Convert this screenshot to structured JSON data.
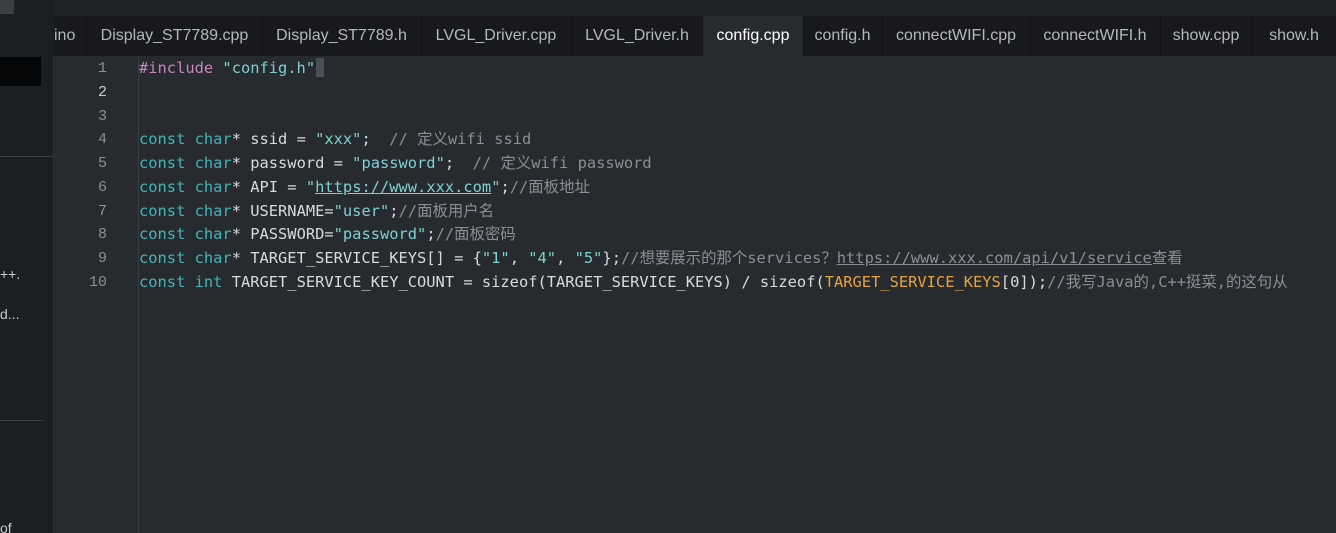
{
  "sidebar": {
    "fragments": [
      "++.",
      "d...",
      "of"
    ]
  },
  "tabs": [
    {
      "label": "ino",
      "active": false
    },
    {
      "label": "Display_ST7789.cpp",
      "active": false
    },
    {
      "label": "Display_ST7789.h",
      "active": false
    },
    {
      "label": "LVGL_Driver.cpp",
      "active": false
    },
    {
      "label": "LVGL_Driver.h",
      "active": false
    },
    {
      "label": "config.cpp",
      "active": true
    },
    {
      "label": "config.h",
      "active": false
    },
    {
      "label": "connectWIFI.cpp",
      "active": false
    },
    {
      "label": "connectWIFI.h",
      "active": false
    },
    {
      "label": "show.cpp",
      "active": false
    },
    {
      "label": "show.h",
      "active": false
    }
  ],
  "editor": {
    "line_numbers": [
      "1",
      "2",
      "3",
      "4",
      "5",
      "6",
      "7",
      "8",
      "9",
      "10"
    ],
    "l1": {
      "directive": "#include",
      "sp": " ",
      "file": "\"config.h\""
    },
    "l4": {
      "kw1": "const",
      "sp1": " ",
      "kw2": "char",
      "rest": "* ssid = ",
      "val": "\"xxx\"",
      "end": ";  ",
      "comment": "// 定义wifi ssid"
    },
    "l5": {
      "kw1": "const",
      "sp1": " ",
      "kw2": "char",
      "rest": "* password = ",
      "val": "\"password\"",
      "end": ";  ",
      "comment": "// 定义wifi password"
    },
    "l6": {
      "kw1": "const",
      "sp1": " ",
      "kw2": "char",
      "rest": "* API = ",
      "q1": "\"",
      "url": "https://www.xxx.com",
      "q2": "\"",
      "end": ";",
      "comment": "//面板地址"
    },
    "l7": {
      "kw1": "const",
      "sp1": " ",
      "kw2": "char",
      "rest": "* USERNAME=",
      "val": "\"user\"",
      "end": ";",
      "comment": "//面板用户名"
    },
    "l8": {
      "kw1": "const",
      "sp1": " ",
      "kw2": "char",
      "rest": "* PASSWORD=",
      "val": "\"password\"",
      "end": ";",
      "comment": "//面板密码"
    },
    "l9": {
      "kw1": "const",
      "sp1": " ",
      "kw2": "char",
      "rest": "* TARGET_SERVICE_KEYS[] = {",
      "v1": "\"1\"",
      "c1": ", ",
      "v2": "\"4\"",
      "c2": ", ",
      "v3": "\"5\"",
      "end": "};",
      "comment": "//想要展示的那个services？",
      "url": "https://www.xxx.com/api/v1/service",
      "comment2": "查看"
    },
    "l10": {
      "kw1": "const",
      "sp1": " ",
      "kw2": "int",
      "rest": " TARGET_SERVICE_KEY_COUNT = sizeof(TARGET_SERVICE_KEYS) / sizeof(",
      "ident": "TARGET_SERVICE_KEYS",
      "idx": "[0]",
      "end": ");",
      "comment": "//我写Java的,C++挺菜,的这句从"
    }
  }
}
